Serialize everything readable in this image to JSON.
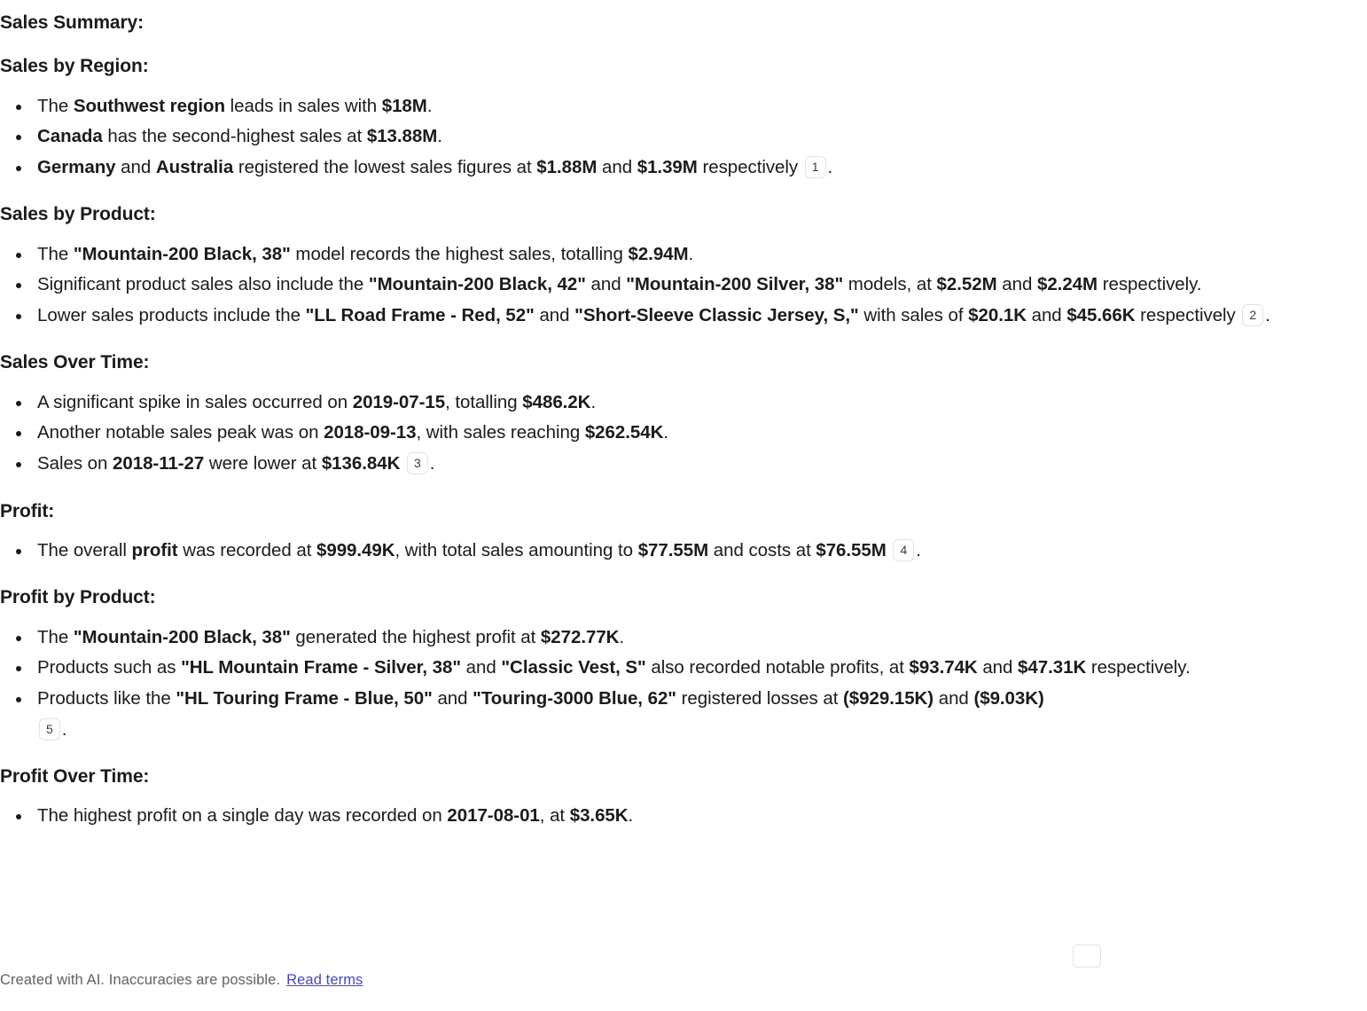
{
  "document": {
    "title": "Sales Summary:",
    "sections": [
      {
        "heading": "Sales by Region:",
        "bullets": [
          {
            "id": "region-southwest",
            "parts": [
              {
                "t": "The ",
                "b": false
              },
              {
                "t": "Southwest region",
                "b": true
              },
              {
                "t": " leads in sales with ",
                "b": false
              },
              {
                "t": "$18M",
                "b": true
              },
              {
                "t": ".",
                "b": false
              }
            ]
          },
          {
            "id": "region-canada",
            "parts": [
              {
                "t": "Canada",
                "b": true
              },
              {
                "t": " has the second-highest sales at ",
                "b": false
              },
              {
                "t": "$13.88M",
                "b": true
              },
              {
                "t": ".",
                "b": false
              }
            ]
          },
          {
            "id": "region-germany-australia",
            "citation": "1",
            "parts": [
              {
                "t": "Germany",
                "b": true
              },
              {
                "t": " and ",
                "b": false
              },
              {
                "t": "Australia",
                "b": true
              },
              {
                "t": " registered the lowest sales figures at ",
                "b": false
              },
              {
                "t": "$1.88M",
                "b": true
              },
              {
                "t": " and ",
                "b": false
              },
              {
                "t": "$1.39M",
                "b": true
              },
              {
                "t": " respectively ",
                "b": false
              }
            ],
            "tail": "."
          }
        ]
      },
      {
        "heading": "Sales by Product:",
        "bullets": [
          {
            "id": "product-mountain200-black-38",
            "parts": [
              {
                "t": "The ",
                "b": false
              },
              {
                "t": "\"Mountain-200 Black, 38\"",
                "b": true
              },
              {
                "t": " model records the highest sales, totalling ",
                "b": false
              },
              {
                "t": "$2.94M",
                "b": true
              },
              {
                "t": ".",
                "b": false
              }
            ]
          },
          {
            "id": "product-significant-sales",
            "parts": [
              {
                "t": "Significant product sales also include the ",
                "b": false
              },
              {
                "t": "\"Mountain-200 Black, 42\"",
                "b": true
              },
              {
                "t": " and ",
                "b": false
              },
              {
                "t": "\"Mountain-200 Silver, 38\"",
                "b": true
              },
              {
                "t": " models, at ",
                "b": false
              },
              {
                "t": "$2.52M",
                "b": true
              },
              {
                "t": " and ",
                "b": false
              },
              {
                "t": "$2.24M",
                "b": true
              },
              {
                "t": " respectively.",
                "b": false
              }
            ]
          },
          {
            "id": "product-lower-sales",
            "citation": "2",
            "parts": [
              {
                "t": "Lower sales products include the ",
                "b": false
              },
              {
                "t": "\"LL Road Frame - Red, 52\"",
                "b": true
              },
              {
                "t": " and ",
                "b": false
              },
              {
                "t": "\"Short-Sleeve Classic Jersey, S,\"",
                "b": true
              },
              {
                "t": " with sales of ",
                "b": false
              },
              {
                "t": "$20.1K",
                "b": true
              },
              {
                "t": " and ",
                "b": false
              },
              {
                "t": "$45.66K",
                "b": true
              },
              {
                "t": " respectively ",
                "b": false
              }
            ],
            "tail": "."
          }
        ]
      },
      {
        "heading": "Sales Over Time:",
        "bullets": [
          {
            "id": "sales-spike-2019",
            "parts": [
              {
                "t": "A significant spike in sales occurred on ",
                "b": false
              },
              {
                "t": "2019-07-15",
                "b": true
              },
              {
                "t": ", totalling ",
                "b": false
              },
              {
                "t": "$486.2K",
                "b": true
              },
              {
                "t": ".",
                "b": false
              }
            ]
          },
          {
            "id": "sales-peak-2018-09",
            "parts": [
              {
                "t": "Another notable sales peak was on ",
                "b": false
              },
              {
                "t": "2018-09-13",
                "b": true
              },
              {
                "t": ", with sales reaching ",
                "b": false
              },
              {
                "t": "$262.54K",
                "b": true
              },
              {
                "t": ".",
                "b": false
              }
            ]
          },
          {
            "id": "sales-low-2018-11",
            "citation": "3",
            "parts": [
              {
                "t": "Sales on ",
                "b": false
              },
              {
                "t": "2018-11-27",
                "b": true
              },
              {
                "t": " were lower at ",
                "b": false
              },
              {
                "t": "$136.84K",
                "b": true
              },
              {
                "t": " ",
                "b": false
              }
            ],
            "tail": "."
          }
        ]
      },
      {
        "heading": "Profit:",
        "bullets": [
          {
            "id": "overall-profit",
            "citation": "4",
            "parts": [
              {
                "t": "The overall ",
                "b": false
              },
              {
                "t": "profit",
                "b": true
              },
              {
                "t": " was recorded at ",
                "b": false
              },
              {
                "t": "$999.49K",
                "b": true
              },
              {
                "t": ", with total sales amounting to ",
                "b": false
              },
              {
                "t": "$77.55M",
                "b": true
              },
              {
                "t": " and costs at ",
                "b": false
              },
              {
                "t": "$76.55M",
                "b": true
              },
              {
                "t": " ",
                "b": false
              }
            ],
            "tail": "."
          }
        ]
      },
      {
        "heading": "Profit by Product:",
        "bullets": [
          {
            "id": "profit-mountain200-black-38",
            "parts": [
              {
                "t": "The ",
                "b": false
              },
              {
                "t": "\"Mountain-200 Black, 38\"",
                "b": true
              },
              {
                "t": " generated the highest profit at ",
                "b": false
              },
              {
                "t": "$272.77K",
                "b": true
              },
              {
                "t": ".",
                "b": false
              }
            ]
          },
          {
            "id": "profit-notable-products",
            "parts": [
              {
                "t": "Products such as ",
                "b": false
              },
              {
                "t": "\"HL Mountain Frame - Silver, 38\"",
                "b": true
              },
              {
                "t": " and ",
                "b": false
              },
              {
                "t": "\"Classic Vest, S\"",
                "b": true
              },
              {
                "t": " also recorded notable profits, at ",
                "b": false
              },
              {
                "t": "$93.74K",
                "b": true
              },
              {
                "t": " and ",
                "b": false
              },
              {
                "t": "$47.31K",
                "b": true
              },
              {
                "t": " respectively.",
                "b": false
              }
            ]
          },
          {
            "id": "profit-losses",
            "citation": "5",
            "citation_on_newline": true,
            "parts": [
              {
                "t": "Products like the ",
                "b": false
              },
              {
                "t": "\"HL Touring Frame - Blue, 50\"",
                "b": true
              },
              {
                "t": " and ",
                "b": false
              },
              {
                "t": "\"Touring-3000 Blue, 62\"",
                "b": true
              },
              {
                "t": " registered losses at ",
                "b": false
              },
              {
                "t": "($929.15K)",
                "b": true
              },
              {
                "t": " and ",
                "b": false
              },
              {
                "t": "($9.03K)",
                "b": true
              },
              {
                "t": " ",
                "b": false
              }
            ],
            "tail": "."
          }
        ]
      },
      {
        "heading": "Profit Over Time:",
        "bullets": [
          {
            "id": "profit-highest-day",
            "parts": [
              {
                "t": "The highest profit on a single day was recorded on ",
                "b": false
              },
              {
                "t": "2017-08-01",
                "b": true
              },
              {
                "t": ", at ",
                "b": false
              },
              {
                "t": "$3.65K",
                "b": true
              },
              {
                "t": ".",
                "b": false
              }
            ]
          }
        ]
      }
    ]
  },
  "footer": {
    "disclaimer": "Created with AI. Inaccuracies are possible.",
    "terms_link": "Read terms"
  },
  "colors": {
    "text": "#1b1b1b",
    "footer_text": "#616161",
    "link": "#4646c8",
    "citation_border": "#e2e2e2",
    "background": "#ffffff"
  }
}
